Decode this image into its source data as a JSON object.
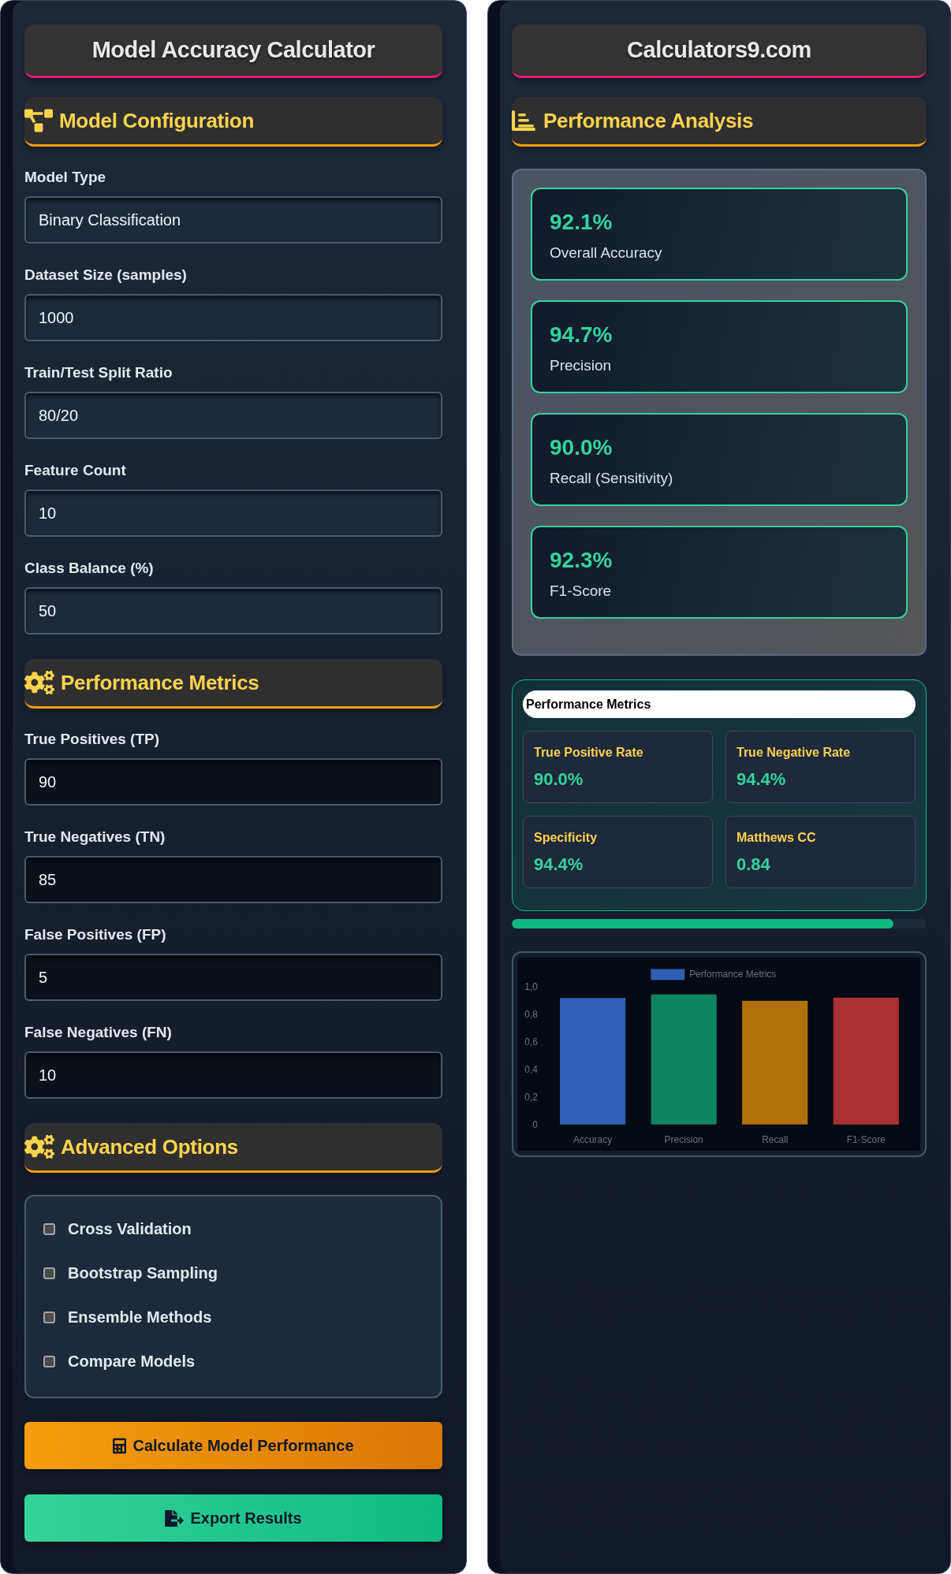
{
  "calculator": {
    "title": "Model Accuracy Calculator",
    "sections": [
      {
        "kind": "config",
        "title": "Model Configuration",
        "fields": [
          {
            "label": "Model Type",
            "value": "Binary Classification"
          },
          {
            "label": "Dataset Size (samples)",
            "value": "1000"
          },
          {
            "label": "Train/Test Split Ratio",
            "value": "80/20"
          },
          {
            "label": "Feature Count",
            "value": "10"
          },
          {
            "label": "Class Balance (%)",
            "value": "50"
          }
        ]
      },
      {
        "kind": "matrix",
        "title": "Performance Metrics",
        "fields": [
          {
            "label": "True Positives (TP)",
            "value": "90"
          },
          {
            "label": "True Negatives (TN)",
            "value": "85"
          },
          {
            "label": "False Positives (FP)",
            "value": "5"
          },
          {
            "label": "False Negatives (FN)",
            "value": "10"
          }
        ]
      },
      {
        "kind": "options",
        "title": "Advanced Options",
        "options": [
          {
            "label": "Cross Validation",
            "checked": false
          },
          {
            "label": "Bootstrap Sampling",
            "checked": false
          },
          {
            "label": "Ensemble Methods",
            "checked": false
          },
          {
            "label": "Compare Models",
            "checked": false
          }
        ]
      }
    ],
    "buttons": [
      {
        "kind": "calculate",
        "label": "Calculate Model Performance"
      },
      {
        "kind": "export",
        "label": "Export Results"
      }
    ]
  },
  "results": {
    "title": "Calculators9.com",
    "section_title": "Performance Analysis",
    "metric_cards": [
      {
        "value": "92.1%",
        "label": "Overall Accuracy"
      },
      {
        "value": "94.7%",
        "label": "Precision"
      },
      {
        "value": "90.0%",
        "label": "Recall (Sensitivity)"
      },
      {
        "value": "92.3%",
        "label": "F1-Score"
      }
    ],
    "metrics_panel": {
      "title": "Performance Metrics",
      "items": [
        {
          "label": "True Positive Rate",
          "value": "90.0%"
        },
        {
          "label": "True Negative Rate",
          "value": "94.4%"
        },
        {
          "label": "Specificity",
          "value": "94.4%"
        },
        {
          "label": "Matthews CC",
          "value": "0.84"
        }
      ]
    },
    "progress": {
      "level": 0.92
    },
    "chart": {
      "chart_data": {
        "type": "bar",
        "categories": [
          "Accuracy",
          "Precision",
          "Recall",
          "F1-Score"
        ],
        "series": [
          {
            "name": "Performance Metrics",
            "color": "#2d5fb5",
            "colors": [
              "#2d5fb5",
              "#0e8460",
              "#b0700c",
              "#a83234"
            ],
            "values": [
              0.921,
              0.947,
              0.9,
              0.923
            ]
          }
        ],
        "ylim": [
          0,
          1
        ],
        "yticks": [
          {
            "value": 0,
            "label": "0"
          },
          {
            "value": 0.2,
            "label": "0,2"
          },
          {
            "value": 0.4,
            "label": "0,4"
          },
          {
            "value": 0.6,
            "label": "0,6"
          },
          {
            "value": 0.8,
            "label": "0,8"
          },
          {
            "value": 1,
            "label": "1,0"
          }
        ]
      }
    }
  }
}
